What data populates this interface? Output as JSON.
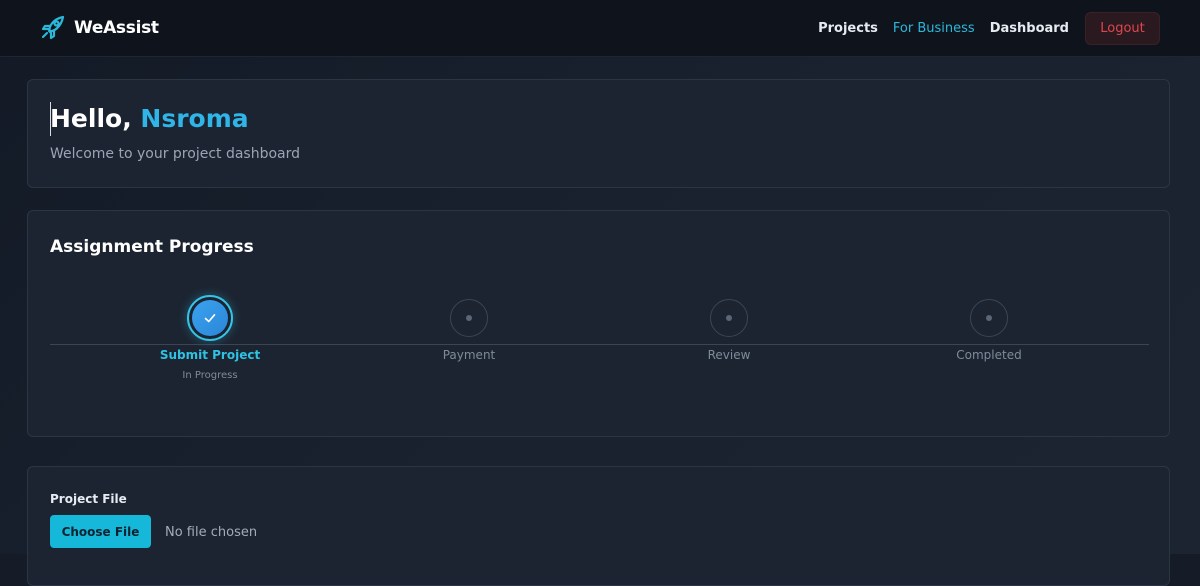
{
  "nav": {
    "brand": "WeAssist",
    "links": [
      "Projects",
      "For Business",
      "Dashboard"
    ],
    "logout": "Logout"
  },
  "greeting": {
    "hello": "Hello,",
    "name": "Nsroma",
    "subtitle": "Welcome to your project dashboard"
  },
  "progress": {
    "title": "Assignment Progress",
    "steps": [
      {
        "label": "Submit Project",
        "status": "In Progress"
      },
      {
        "label": "Payment"
      },
      {
        "label": "Review"
      },
      {
        "label": "Completed"
      }
    ]
  },
  "file": {
    "label": "Project File",
    "button": "Choose File",
    "status": "No file chosen"
  },
  "colors": {
    "accent": "#2fb5e8",
    "button": "#16b8da",
    "logout": "#e0454f"
  }
}
